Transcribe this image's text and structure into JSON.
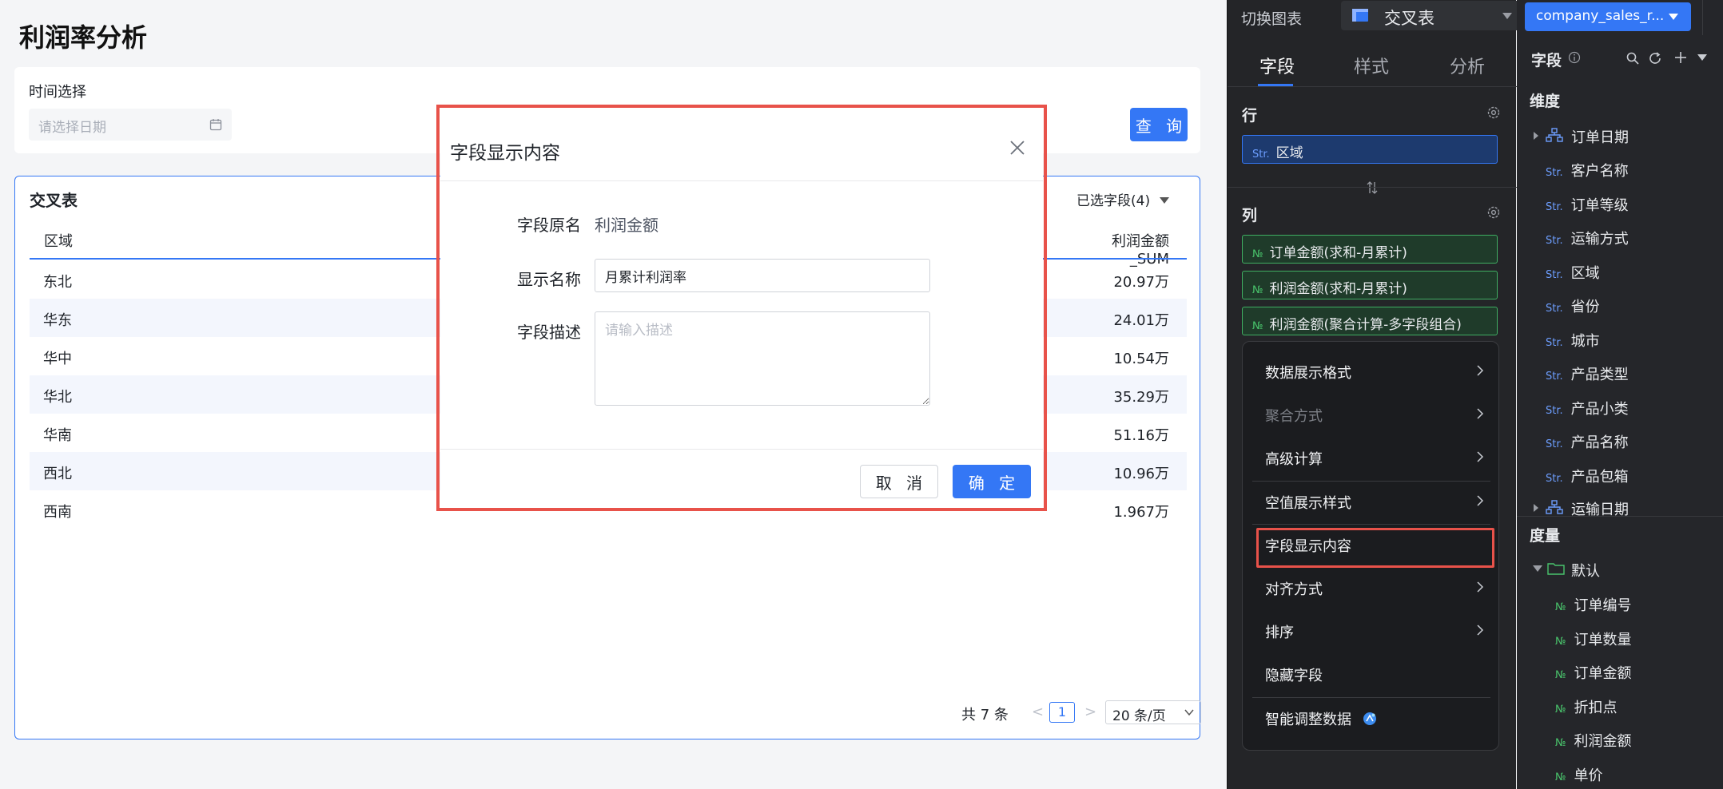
{
  "page": {
    "title": "利润率分析"
  },
  "filter": {
    "time_label": "时间选择",
    "date_placeholder": "请选择日期",
    "query_label": "查 询"
  },
  "table": {
    "title": "交叉表",
    "selected_fields": "已选字段(4)",
    "columns": [
      "区域",
      "利润金额_SUM"
    ],
    "rows": [
      [
        "东北",
        "20.97万"
      ],
      [
        "华东",
        "24.01万"
      ],
      [
        "华中",
        "10.54万"
      ],
      [
        "华北",
        "35.29万"
      ],
      [
        "华南",
        "51.16万"
      ],
      [
        "西北",
        "10.96万"
      ],
      [
        "西南",
        "1.967万"
      ]
    ],
    "pagination": {
      "total": "共 7 条",
      "current_page": "1",
      "page_size": "20 条/页"
    }
  },
  "modal": {
    "title": "字段显示内容",
    "origin_label": "字段原名",
    "origin_value": "利润金额",
    "display_label": "显示名称",
    "display_value": "月累计利润率",
    "desc_label": "字段描述",
    "desc_placeholder": "请输入描述",
    "cancel_label": "取 消",
    "ok_label": "确 定"
  },
  "config": {
    "switch_chart_label": "切换图表",
    "chart_type": "交叉表",
    "tabs": [
      "字段",
      "样式",
      "分析"
    ],
    "active_tab": "字段",
    "rows_title": "行",
    "row_fields": [
      {
        "tag": "Str.",
        "name": "区域"
      }
    ],
    "cols_title": "列",
    "col_fields": [
      {
        "tag": "№",
        "name": "订单金额(求和-月累计)"
      },
      {
        "tag": "№",
        "name": "利润金额(求和-月累计)"
      },
      {
        "tag": "№",
        "name": "利润金额(聚合计算-多字段组合)"
      }
    ],
    "context_menu": [
      {
        "label": "数据展示格式",
        "submenu": true,
        "disabled": false
      },
      {
        "label": "聚合方式",
        "submenu": true,
        "disabled": true
      },
      {
        "label": "高级计算",
        "submenu": true,
        "disabled": false
      },
      {
        "label": "空值展示样式",
        "submenu": true,
        "disabled": false
      },
      {
        "label": "字段显示内容",
        "submenu": false,
        "disabled": false
      },
      {
        "label": "对齐方式",
        "submenu": true,
        "disabled": false
      },
      {
        "label": "排序",
        "submenu": true,
        "disabled": false
      },
      {
        "label": "隐藏字段",
        "submenu": false,
        "disabled": false
      },
      {
        "label": "智能调整数据",
        "submenu": false,
        "disabled": false
      }
    ]
  },
  "datasource": {
    "dataset_name": "company_sales_r...",
    "fields_title": "字段",
    "dimension_title": "维度",
    "dimensions": [
      {
        "tag": "",
        "name": "订单日期",
        "hierarchy": true
      },
      {
        "tag": "Str.",
        "name": "客户名称"
      },
      {
        "tag": "Str.",
        "name": "订单等级"
      },
      {
        "tag": "Str.",
        "name": "运输方式"
      },
      {
        "tag": "Str.",
        "name": "区域"
      },
      {
        "tag": "Str.",
        "name": "省份"
      },
      {
        "tag": "Str.",
        "name": "城市"
      },
      {
        "tag": "Str.",
        "name": "产品类型"
      },
      {
        "tag": "Str.",
        "name": "产品小类"
      },
      {
        "tag": "Str.",
        "name": "产品名称"
      },
      {
        "tag": "Str.",
        "name": "产品包箱"
      },
      {
        "tag": "",
        "name": "运输日期",
        "hierarchy": true
      }
    ],
    "measure_title": "度量",
    "measure_folder": "默认",
    "measures": [
      {
        "tag": "№",
        "name": "订单编号"
      },
      {
        "tag": "№",
        "name": "订单数量"
      },
      {
        "tag": "№",
        "name": "订单金额"
      },
      {
        "tag": "№",
        "name": "折扣点"
      },
      {
        "tag": "№",
        "name": "利润金额"
      },
      {
        "tag": "№",
        "name": "单价"
      }
    ]
  },
  "colors": {
    "accent": "#3477f5",
    "highlight": "#e8524a",
    "measure_green": "#49c46c",
    "dark_panel": "#242528"
  }
}
